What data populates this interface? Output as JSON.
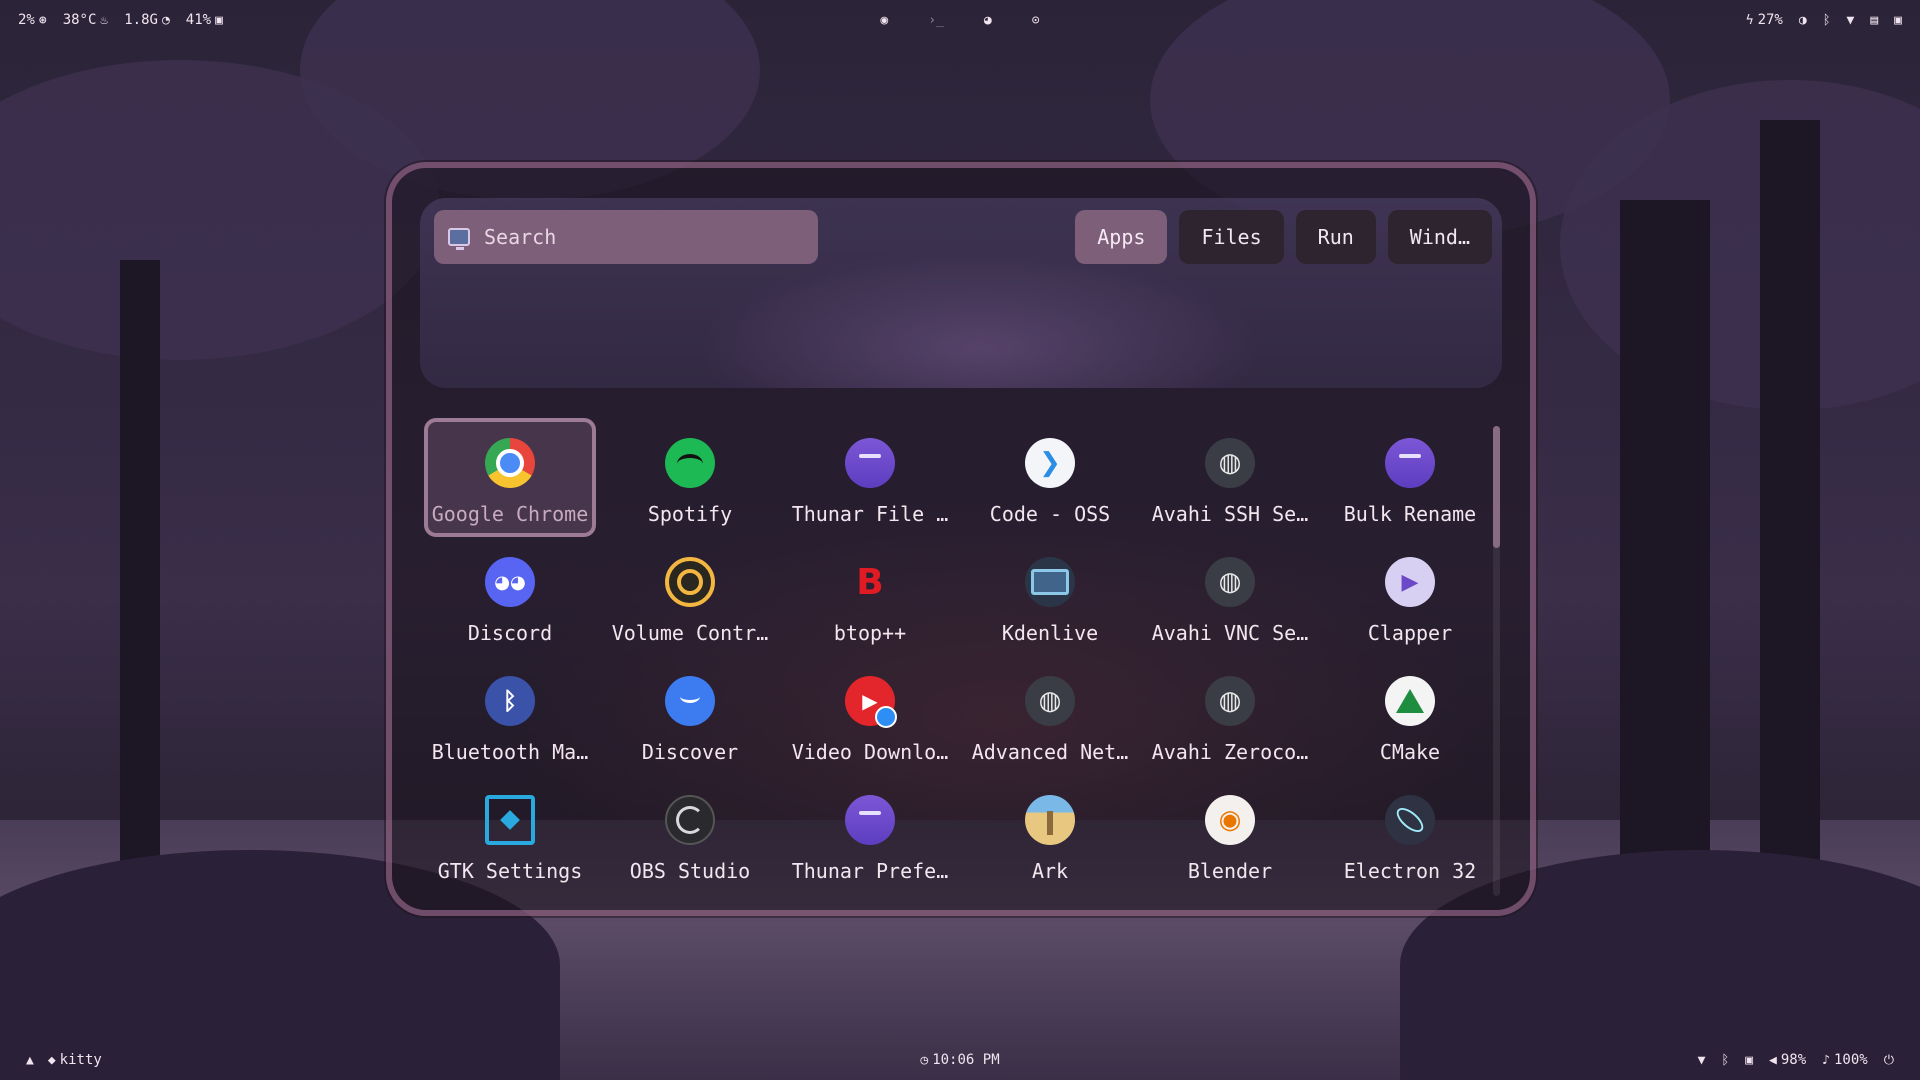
{
  "topbar": {
    "cpu": "2%",
    "temp": "38°C",
    "memory": "1.8G",
    "disk": "41%",
    "battery": "27%"
  },
  "launcher": {
    "search_placeholder": "Search",
    "tabs": [
      {
        "label": "Apps",
        "active": true
      },
      {
        "label": "Files",
        "active": false
      },
      {
        "label": "Run",
        "active": false
      },
      {
        "label": "Wind…",
        "active": false
      }
    ],
    "apps": [
      {
        "label": "Google Chrome",
        "icon": "chrome-icon",
        "glyph": "",
        "style": "ic-chrome",
        "selected": true
      },
      {
        "label": "Spotify",
        "icon": "spotify-icon",
        "glyph": "",
        "style": "ic-spotify"
      },
      {
        "label": "Thunar File …",
        "icon": "folder-icon",
        "glyph": "",
        "style": "ic-folder"
      },
      {
        "label": "Code - OSS",
        "icon": "vscode-icon",
        "glyph": "❯",
        "style": "ic-code"
      },
      {
        "label": "Avahi SSH Se…",
        "icon": "network-globe-icon",
        "glyph": "◍",
        "style": "ic-globe"
      },
      {
        "label": "Bulk Rename",
        "icon": "folder-icon",
        "glyph": "",
        "style": "ic-folder"
      },
      {
        "label": "Discord",
        "icon": "discord-icon",
        "glyph": "◕◕",
        "style": "ic-discord"
      },
      {
        "label": "Volume Contr…",
        "icon": "volume-control-icon",
        "glyph": "",
        "style": "ic-volume"
      },
      {
        "label": "btop++",
        "icon": "btop-icon",
        "glyph": "B",
        "style": "ic-btop"
      },
      {
        "label": "Kdenlive",
        "icon": "kdenlive-icon",
        "glyph": "",
        "style": "ic-kdenlive"
      },
      {
        "label": "Avahi VNC Se…",
        "icon": "network-globe-icon",
        "glyph": "◍",
        "style": "ic-globe"
      },
      {
        "label": "Clapper",
        "icon": "clapper-icon",
        "glyph": "▶",
        "style": "ic-clapper"
      },
      {
        "label": "Bluetooth Ma…",
        "icon": "bluetooth-icon",
        "glyph": "ᛒ",
        "style": "ic-bluetooth"
      },
      {
        "label": "Discover",
        "icon": "discover-icon",
        "glyph": "",
        "style": "ic-discover"
      },
      {
        "label": "Video Downlo…",
        "icon": "video-download-icon",
        "glyph": "▶",
        "style": "ic-video"
      },
      {
        "label": "Advanced Net…",
        "icon": "network-globe-icon",
        "glyph": "◍",
        "style": "ic-globe"
      },
      {
        "label": "Avahi Zeroco…",
        "icon": "network-globe-icon",
        "glyph": "◍",
        "style": "ic-globe"
      },
      {
        "label": "CMake",
        "icon": "cmake-icon",
        "glyph": "",
        "style": "ic-cmake"
      },
      {
        "label": "GTK Settings",
        "icon": "gtk-settings-icon",
        "glyph": "",
        "style": "ic-gtk"
      },
      {
        "label": "OBS Studio",
        "icon": "obs-icon",
        "glyph": "",
        "style": "ic-obs"
      },
      {
        "label": "Thunar Prefe…",
        "icon": "folder-icon",
        "glyph": "",
        "style": "ic-folder"
      },
      {
        "label": "Ark",
        "icon": "ark-archive-icon",
        "glyph": "",
        "style": "ic-ark"
      },
      {
        "label": "Blender",
        "icon": "blender-icon",
        "glyph": "◉",
        "style": "ic-blender"
      },
      {
        "label": "Electron 32",
        "icon": "electron-icon",
        "glyph": "",
        "style": "ic-electron"
      }
    ]
  },
  "bottombar": {
    "active_window": "kitty",
    "clock": "10:06 PM",
    "volume": "98%",
    "mic": "100%"
  },
  "colors": {
    "accent": "#7d5f79",
    "border": "#b078a0",
    "text": "#f1e4ef"
  }
}
